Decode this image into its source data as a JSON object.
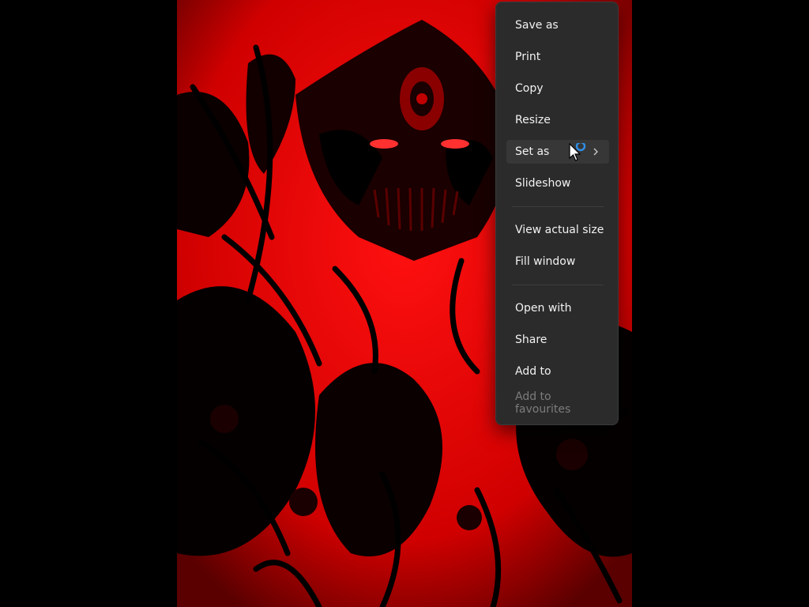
{
  "menu": {
    "items": [
      {
        "label": "Save as",
        "enabled": true
      },
      {
        "label": "Print",
        "enabled": true
      },
      {
        "label": "Copy",
        "enabled": true
      },
      {
        "label": "Resize",
        "enabled": true
      },
      {
        "label": "Set as",
        "enabled": true,
        "has_submenu": true,
        "hovered": true
      },
      {
        "label": "Slideshow",
        "enabled": true
      },
      {
        "label": "View actual size",
        "enabled": true
      },
      {
        "label": "Fill window",
        "enabled": true
      },
      {
        "label": "Open with",
        "enabled": true
      },
      {
        "label": "Share",
        "enabled": true
      },
      {
        "label": "Add to",
        "enabled": true
      },
      {
        "label": "Add to favourites",
        "enabled": false
      }
    ]
  },
  "icons": {
    "submenu_arrow": "chevron-right-icon",
    "cursor": "arrow-cursor-with-busy-ring-icon"
  },
  "colors": {
    "menu_background": "#2b2b2b",
    "menu_text": "#f2f2f2",
    "disabled_text": "#7c7c7c",
    "hover_background": "#373737",
    "artwork_red": "#d10000",
    "busy_ring": "#2f8fe8"
  }
}
